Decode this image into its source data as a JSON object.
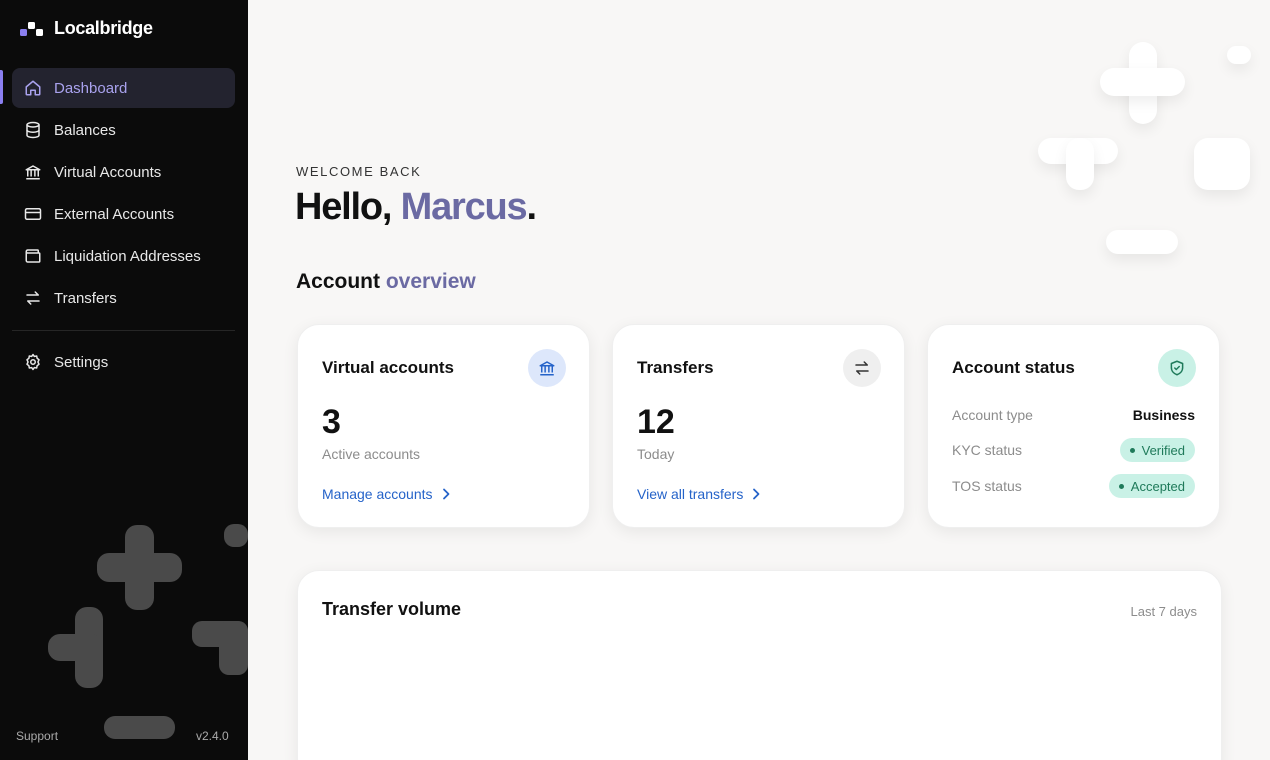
{
  "brand": {
    "name": "Localbridge",
    "logo_colors": [
      "#8b7ff0",
      "#ffffff"
    ]
  },
  "sidebar": {
    "items": [
      {
        "label": "Dashboard",
        "icon": "home-icon",
        "active": true
      },
      {
        "label": "Balances",
        "icon": "database-icon",
        "active": false
      },
      {
        "label": "Virtual Accounts",
        "icon": "bank-icon",
        "active": false
      },
      {
        "label": "External Accounts",
        "icon": "card-icon",
        "active": false
      },
      {
        "label": "Liquidation Addresses",
        "icon": "wallet-icon",
        "active": false
      },
      {
        "label": "Transfers",
        "icon": "transfer-arrows-icon",
        "active": false
      }
    ],
    "settings": {
      "label": "Settings",
      "icon": "gear-icon"
    },
    "footer": {
      "support": "Support",
      "version": "v2.4.0"
    }
  },
  "header": {
    "eyebrow": "WELCOME BACK",
    "greeting": "Hello,",
    "name": "Marcus",
    "punctuation": "."
  },
  "overview": {
    "title": "Account",
    "title_accent": "overview"
  },
  "cards": {
    "virtual_accounts": {
      "title": "Virtual accounts",
      "icon": "bank-icon",
      "value": "3",
      "sub": "Active accounts",
      "link": "Manage accounts"
    },
    "transfers": {
      "title": "Transfers",
      "icon": "transfer-arrows-icon",
      "value": "12",
      "sub": "Today",
      "link": "View all transfers"
    },
    "account_status": {
      "title": "Account status",
      "icon": "shield-check-icon",
      "rows": [
        {
          "label": "Account type",
          "value": "Business"
        },
        {
          "label": "KYC status",
          "value": "Verified"
        },
        {
          "label": "TOS status",
          "value": "Accepted"
        }
      ]
    }
  },
  "transfer_volume": {
    "title": "Transfer volume",
    "range": "Last 7 days"
  },
  "colors": {
    "accent": "#6b6aa3",
    "link": "#2563c9",
    "active_nav": "#a9a2ee",
    "success_bg": "#c9f1e6",
    "success_text": "#1f7a5a",
    "sidebar_bg": "#0b0b0b"
  }
}
